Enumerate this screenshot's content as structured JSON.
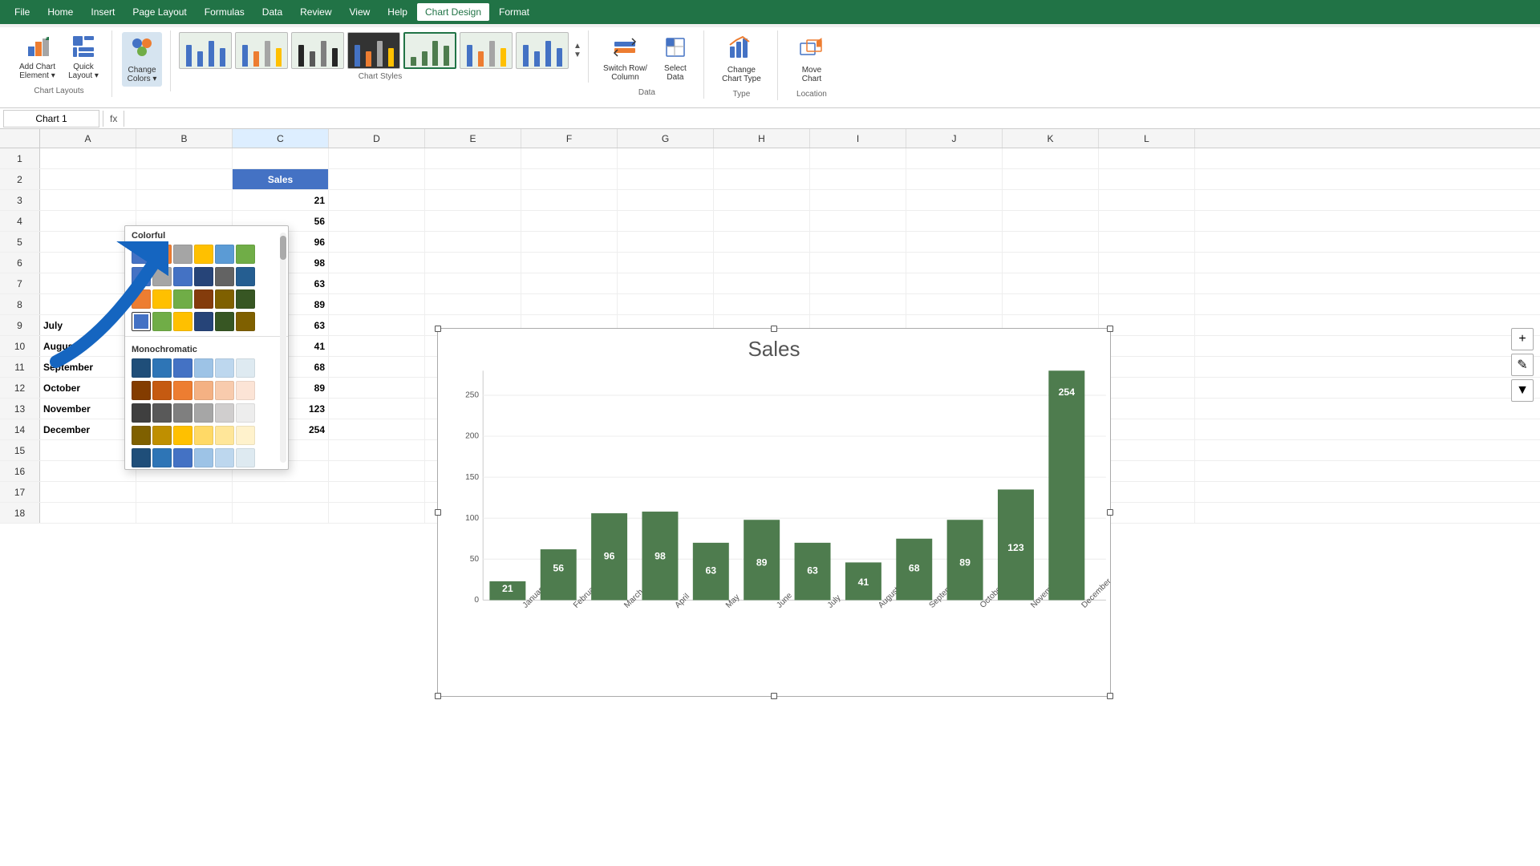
{
  "menu": {
    "items": [
      "File",
      "Home",
      "Insert",
      "Page Layout",
      "Formulas",
      "Data",
      "Review",
      "View",
      "Help",
      "Chart Design",
      "Format"
    ],
    "active": "Chart Design"
  },
  "ribbon": {
    "groups": [
      {
        "label": "Chart Layouts",
        "buttons": [
          {
            "label": "Add Chart\nElement",
            "icon": "➕"
          },
          {
            "label": "Quick\nLayout",
            "icon": "▦"
          }
        ]
      },
      {
        "label": "Change Colors",
        "buttons": [
          {
            "label": "Change\nColors",
            "icon": "🎨"
          }
        ]
      },
      {
        "label": "Chart Styles",
        "styles_count": 8
      },
      {
        "label": "Data",
        "buttons": [
          {
            "label": "Switch Row/\nColumn",
            "icon": "⇄"
          },
          {
            "label": "Select\nData",
            "icon": "📋"
          }
        ]
      },
      {
        "label": "Type",
        "buttons": [
          {
            "label": "Change\nChart Type",
            "icon": "📊"
          }
        ]
      },
      {
        "label": "Location",
        "buttons": [
          {
            "label": "Move\nChart",
            "icon": "↗"
          }
        ]
      }
    ]
  },
  "namebox": {
    "value": "Chart 1",
    "placeholder": ""
  },
  "columns": [
    "A",
    "B",
    "C",
    "D",
    "E",
    "F",
    "G",
    "H",
    "I",
    "J",
    "K",
    "L"
  ],
  "rows": [
    {
      "num": 1,
      "cells": [
        "",
        "",
        "",
        "",
        "",
        "",
        "",
        "",
        "",
        "",
        "",
        ""
      ]
    },
    {
      "num": 2,
      "cells": [
        "",
        "",
        "Sales",
        "",
        "",
        "",
        "",
        "",
        "",
        "",
        "",
        ""
      ]
    },
    {
      "num": 3,
      "cells": [
        "",
        "",
        "21",
        "",
        "",
        "",
        "",
        "",
        "",
        "",
        "",
        ""
      ]
    },
    {
      "num": 4,
      "cells": [
        "",
        "",
        "56",
        "",
        "",
        "",
        "",
        "",
        "",
        "",
        "",
        ""
      ]
    },
    {
      "num": 5,
      "cells": [
        "",
        "",
        "96",
        "",
        "",
        "",
        "",
        "",
        "",
        "",
        "",
        ""
      ]
    },
    {
      "num": 6,
      "cells": [
        "",
        "",
        "98",
        "",
        "",
        "",
        "",
        "",
        "",
        "",
        "",
        ""
      ]
    },
    {
      "num": 7,
      "cells": [
        "",
        "",
        "63",
        "",
        "",
        "",
        "",
        "",
        "",
        "",
        "",
        ""
      ]
    },
    {
      "num": 8,
      "cells": [
        "",
        "",
        "89",
        "",
        "",
        "",
        "",
        "",
        "",
        "",
        "",
        ""
      ]
    },
    {
      "num": 9,
      "cells": [
        "July",
        "",
        "63",
        "",
        "",
        "",
        "",
        "",
        "",
        "",
        "",
        ""
      ]
    },
    {
      "num": 10,
      "cells": [
        "August",
        "",
        "41",
        "",
        "",
        "",
        "",
        "",
        "",
        "",
        "",
        ""
      ]
    },
    {
      "num": 11,
      "cells": [
        "September",
        "",
        "68",
        "",
        "",
        "",
        "",
        "",
        "",
        "",
        "",
        ""
      ]
    },
    {
      "num": 12,
      "cells": [
        "October",
        "",
        "89",
        "",
        "",
        "",
        "",
        "",
        "",
        "",
        "",
        ""
      ]
    },
    {
      "num": 13,
      "cells": [
        "November",
        "",
        "123",
        "",
        "",
        "",
        "",
        "",
        "",
        "",
        "",
        ""
      ]
    },
    {
      "num": 14,
      "cells": [
        "December",
        "",
        "254",
        "",
        "",
        "",
        "",
        "",
        "",
        "",
        "",
        ""
      ]
    },
    {
      "num": 15,
      "cells": [
        "",
        "",
        "",
        "",
        "",
        "",
        "",
        "",
        "",
        "",
        "",
        ""
      ]
    },
    {
      "num": 16,
      "cells": [
        "",
        "",
        "",
        "",
        "",
        "",
        "",
        "",
        "",
        "",
        "",
        ""
      ]
    },
    {
      "num": 17,
      "cells": [
        "",
        "",
        "",
        "",
        "",
        "",
        "",
        "",
        "",
        "",
        "",
        ""
      ]
    },
    {
      "num": 18,
      "cells": [
        "",
        "",
        "",
        "",
        "",
        "",
        "",
        "",
        "",
        "",
        "",
        ""
      ]
    }
  ],
  "chart": {
    "title": "Sales",
    "bars": [
      {
        "month": "January",
        "value": 21
      },
      {
        "month": "February",
        "value": 56
      },
      {
        "month": "March",
        "value": 96
      },
      {
        "month": "April",
        "value": 98
      },
      {
        "month": "May",
        "value": 63
      },
      {
        "month": "June",
        "value": 89
      },
      {
        "month": "July",
        "value": 63
      },
      {
        "month": "August",
        "value": 41
      },
      {
        "month": "September",
        "value": 68
      },
      {
        "month": "October",
        "value": 89
      },
      {
        "month": "November",
        "value": 123
      },
      {
        "month": "December",
        "value": 254
      }
    ],
    "bar_color": "#4e7c4e",
    "bar_color_highlight": "#5a8f5a"
  },
  "dropdown": {
    "title": "Colorful",
    "section_mono": "Monochromatic",
    "colorful_rows": [
      [
        "#4472c4",
        "#ed7d31",
        "#a5a5a5",
        "#ffc000",
        "#5b9bd5",
        "#70ad47"
      ],
      [
        "#4472c4",
        "#a5a5a5",
        "#4472c4",
        "#264478",
        "#636363",
        "#255e91"
      ],
      [
        "#ed7d31",
        "#ffc000",
        "#70ad47",
        "#843c0c",
        "#7f6000",
        "#375623"
      ],
      [
        "#4472c4",
        "#70ad47",
        "#ffc000",
        "#264478",
        "#375623",
        "#7f6000"
      ]
    ],
    "mono_rows": [
      [
        "#1f4e79",
        "#2e75b6",
        "#4472c4",
        "#9dc3e6",
        "#bdd7ee",
        "#deeaf1"
      ],
      [
        "#833c00",
        "#c55a11",
        "#ed7d31",
        "#f4b183",
        "#f8cbad",
        "#fce4d6"
      ],
      [
        "#3f3f3f",
        "#595959",
        "#7f7f7f",
        "#a6a6a6",
        "#d0cece",
        "#ededed"
      ],
      [
        "#7f6000",
        "#bf8f00",
        "#ffc000",
        "#ffd966",
        "#ffe699",
        "#fff2cc"
      ],
      [
        "#1f4e79",
        "#2e75b6",
        "#4472c4",
        "#9dc3e6",
        "#bdd7ee",
        "#deeaf1"
      ]
    ]
  }
}
